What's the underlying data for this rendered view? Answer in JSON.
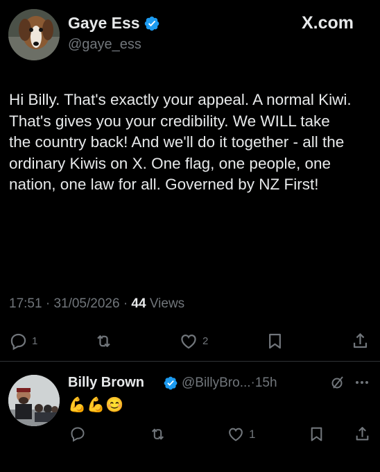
{
  "tweet": {
    "author_name": "Gaye Ess",
    "author_handle": "@gaye_ess",
    "source": "X.com",
    "text": "Hi Billy. That's exactly your appeal. A normal Kiwi. That's gives you your credibility. We WILL take the country back! And we'll do it together - all the ordinary Kiwis on X. One flag, one people, one nation, one law for all. Governed by NZ First!",
    "time": "17:51",
    "date": "31/05/2026",
    "separator": "·",
    "views_count": "44",
    "views_label": "Views",
    "actions": {
      "replies": "1",
      "reposts": "",
      "likes": "2"
    }
  },
  "reply": {
    "author_name": "Billy Brown",
    "author_handle": "@BillyBro...",
    "separator": "·",
    "age": "15h",
    "text": "💪💪😊",
    "actions": {
      "replies": "",
      "reposts": "",
      "likes": "1"
    }
  },
  "colors": {
    "background": "#000000",
    "text": "#e7e9ea",
    "muted": "#71767b",
    "verified": "#1d9bf0"
  },
  "icons": [
    "verified-badge-icon",
    "x-logo",
    "reply-icon",
    "repost-icon",
    "like-icon",
    "bookmark-icon",
    "share-icon",
    "grok-icon",
    "more-icon"
  ]
}
